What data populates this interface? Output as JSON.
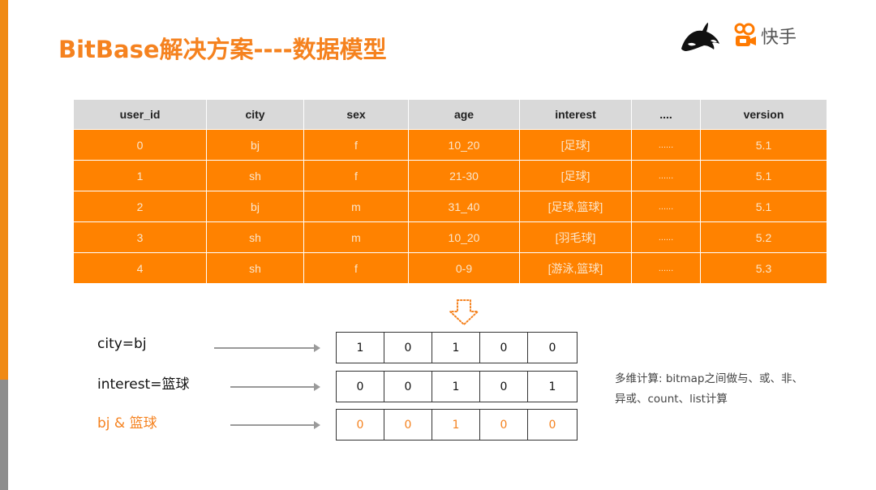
{
  "title": "BitBase解决方案----数据模型",
  "logos": {
    "left_icon": "orca-icon",
    "brand_icon": "kuaishou-icon",
    "brand_name": "快手"
  },
  "colors": {
    "accent": "#f5821f",
    "table_header_bg": "#d9d9d9",
    "table_row_bg": "#ff8200",
    "side_bar_orange": "#f08a14",
    "side_bar_gray": "#8e8e8e"
  },
  "table": {
    "headers": [
      "user_id",
      "city",
      "sex",
      "age",
      "interest",
      "....",
      "version"
    ],
    "rows": [
      [
        "0",
        "bj",
        "f",
        "10_20",
        "[足球]",
        "......",
        "5.1"
      ],
      [
        "1",
        "sh",
        "f",
        "21-30",
        "[足球]",
        "......",
        "5.1"
      ],
      [
        "2",
        "bj",
        "m",
        "31_40",
        "[足球,篮球]",
        "......",
        "5.1"
      ],
      [
        "3",
        "sh",
        "m",
        "10_20",
        "[羽毛球]",
        "......",
        "5.2"
      ],
      [
        "4",
        "sh",
        "f",
        "0-9",
        "[游泳,篮球]",
        "......",
        "5.3"
      ]
    ]
  },
  "transform_icon": "dotted-down-arrow-icon",
  "bitmaps": [
    {
      "label": "city=bj",
      "bits": [
        "1",
        "0",
        "1",
        "0",
        "0"
      ]
    },
    {
      "label": "interest=篮球",
      "bits": [
        "0",
        "0",
        "1",
        "0",
        "1"
      ]
    },
    {
      "label": "bj & 篮球",
      "bits": [
        "0",
        "0",
        "1",
        "0",
        "0"
      ]
    }
  ],
  "note": {
    "line1": "多维计算: bitmap之间做与、或、非、",
    "line2": "异或、count、list计算"
  }
}
